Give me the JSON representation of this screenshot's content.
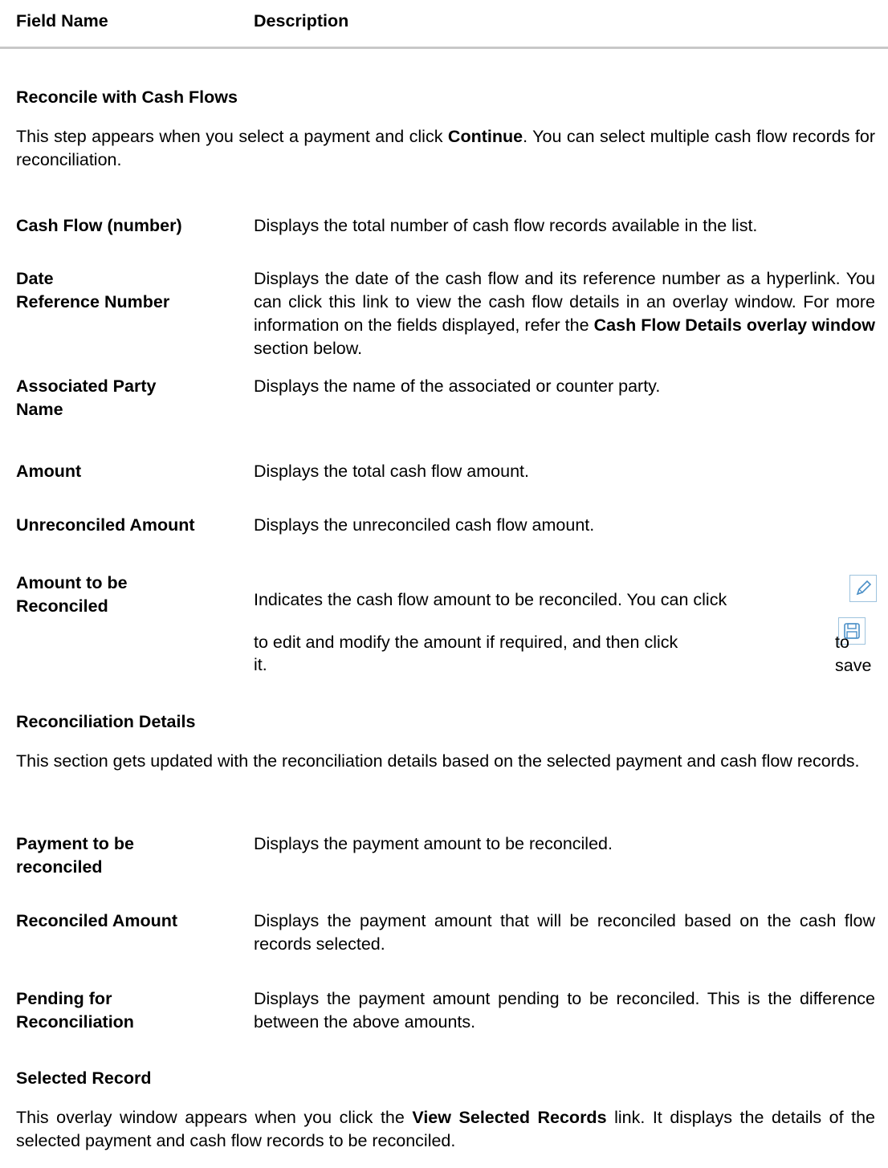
{
  "header": {
    "col1": "Field Name",
    "col2": "Description"
  },
  "sections": {
    "reconcile": {
      "title": "Reconcile with Cash Flows",
      "intro_pre": "This step appears when you select a payment and click ",
      "intro_bold": "Continue",
      "intro_post": ". You can select multiple cash flow records for reconciliation."
    },
    "details": {
      "title": "Reconciliation Details",
      "intro": "This section gets updated with the reconciliation details based on the selected payment and cash flow records."
    },
    "selected": {
      "title": "Selected Record",
      "intro_pre": "This overlay window appears when you click the ",
      "intro_bold": "View Selected Records",
      "intro_post": " link. It displays the details of the selected payment and cash flow records to be reconciled."
    }
  },
  "rows": {
    "cash_flow_number": {
      "label": "Cash Flow (number)",
      "desc": "Displays the total number of cash flow records available in the list."
    },
    "date_ref": {
      "label1": "Date",
      "label2": "Reference Number",
      "desc_pre": "Displays the date of the cash flow and its reference number as a hyperlink. You can click this link to view the cash flow details in an overlay window. For more information on the fields displayed, refer the ",
      "desc_bold": "Cash Flow Details overlay window",
      "desc_post": " section below."
    },
    "party": {
      "label1": "Associated Party",
      "label2": "Name",
      "desc": "Displays the name of the associated or counter party."
    },
    "amount": {
      "label": "Amount",
      "desc": "Displays the total cash flow amount."
    },
    "unreconciled": {
      "label": "Unreconciled Amount",
      "desc": "Displays the unreconciled cash flow amount."
    },
    "to_reconcile": {
      "label1": "Amount to be",
      "label2": "Reconciled",
      "desc_1": "Indicates the cash flow amount to be reconciled. You can click",
      "desc_2": "to edit and modify the amount if required, and then click",
      "desc_3": "to save",
      "desc_4": "it.",
      "icon_edit": "pencil-icon",
      "icon_save": "floppy-disk-icon"
    },
    "payment_to_reconcile": {
      "label1": "Payment to be",
      "label2": "reconciled",
      "desc": "Displays the payment amount to be reconciled."
    },
    "reconciled_amount": {
      "label": "Reconciled Amount",
      "desc": "Displays the payment amount that will be reconciled based on the cash flow records selected."
    },
    "pending": {
      "label1": "Pending for",
      "label2": "Reconciliation",
      "desc": "Displays the payment amount pending to be reconciled. This is the difference between the above amounts."
    }
  }
}
